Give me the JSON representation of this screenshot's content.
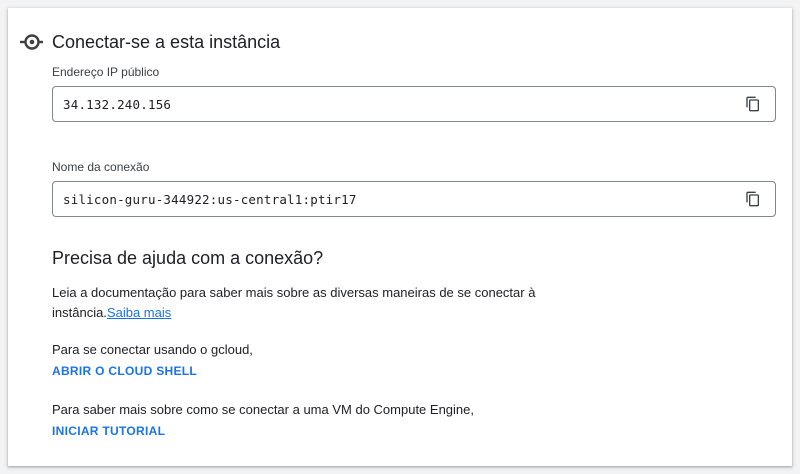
{
  "connect": {
    "title": "Conectar-se a esta instância",
    "icon": "connect-icon"
  },
  "fields": {
    "public_ip": {
      "label": "Endereço IP público",
      "value": "34.132.240.156",
      "copy_icon": "copy-icon"
    },
    "connection_name": {
      "label": "Nome da conexão",
      "value": "silicon-guru-344922:us-central1:ptir17",
      "copy_icon": "copy-icon"
    }
  },
  "help": {
    "title": "Precisa de ajuda com a conexão?",
    "docs_text_line1": "Leia a documentação para saber mais sobre as diversas maneiras de se conectar à",
    "docs_text_line2": "instância.",
    "learn_more": "Saiba mais",
    "gcloud_text": "Para se conectar usando o gcloud,",
    "cloud_shell_button": "ABRIR O CLOUD SHELL",
    "compute_text": "Para saber mais sobre como se conectar a uma VM do Compute Engine,",
    "tutorial_button": "INICIAR TUTORIAL"
  },
  "colors": {
    "accent": "#1a73e8",
    "text": "#202124",
    "border": "#80868b"
  }
}
